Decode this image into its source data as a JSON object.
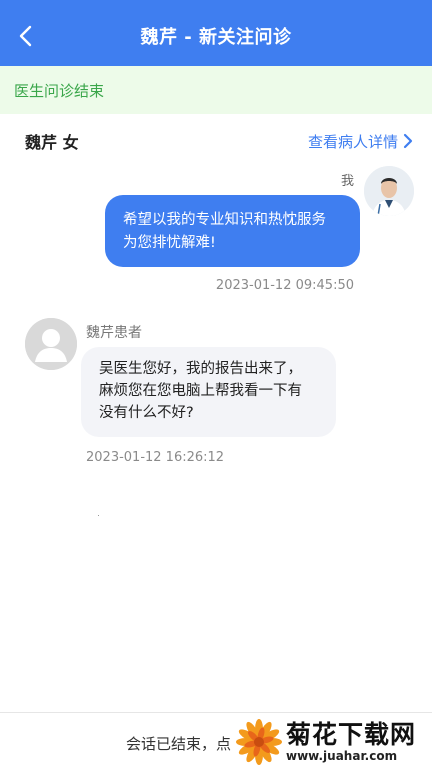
{
  "header": {
    "title": "魏芹 - 新关注问诊",
    "back_icon": "chevron-left-icon"
  },
  "status": {
    "text": "医生问诊结束"
  },
  "patient": {
    "name_gender": "魏芹 女",
    "detail_link": "查看病人详情"
  },
  "messages": [
    {
      "sender": "我",
      "text_line1": "希望以我的专业知识和热忱服务",
      "text_line2": "为您排忧解难!",
      "time": "2023-01-12 09:45:50"
    },
    {
      "sender": "魏芹患者",
      "text_line1": "吴医生您好，我的报告出来了，",
      "text_line2": "麻烦您在您电脑上帮我看一下有",
      "text_line3": "没有什么不好?",
      "time": "2023-01-12 16:26:12"
    }
  ],
  "footer": {
    "text": "会话已结束，点"
  },
  "watermark": {
    "cn": "菊花下载网",
    "en": "www.juahar.com"
  },
  "colors": {
    "primary": "#3f7ef0",
    "status_bg": "#edfbe9",
    "status_text": "#3aa64a",
    "incoming_bubble": "#f3f4f8"
  }
}
